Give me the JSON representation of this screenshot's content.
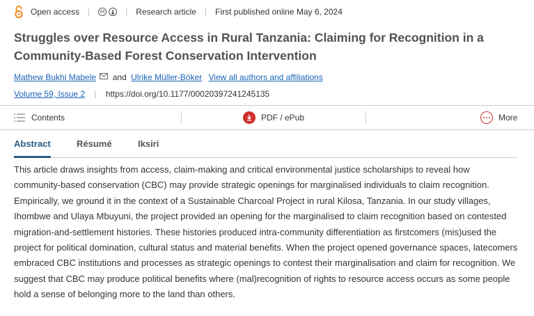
{
  "meta": {
    "access_label": "Open access",
    "cc_icons": [
      "cc-icon",
      "by-icon"
    ],
    "article_type": "Research article",
    "published": "First published online May 6, 2024"
  },
  "article": {
    "title": "Struggles over Resource Access in Rural Tanzania: Claiming for Recognition in a Community-Based Forest Conservation Intervention",
    "author1": "Mathew Bukhi Mabele",
    "and_text": "and",
    "author2": "Ulrike Müller-Böker",
    "view_all": "View all authors and affiliations",
    "volume": "Volume 59, Issue 2",
    "doi": "https://doi.org/10.1177/00020397241245135"
  },
  "toolbar": {
    "contents_label": "Contents",
    "pdf_label": "PDF / ePub",
    "more_label": "More"
  },
  "tabs": [
    {
      "label": "Abstract",
      "active": true
    },
    {
      "label": "Résumé",
      "active": false
    },
    {
      "label": "Iksiri",
      "active": false
    }
  ],
  "abstract": "This article draws insights from access, claim-making and critical environmental justice scholarships to reveal how community-based conservation (CBC) may provide strategic openings for marginalised individuals to claim recognition. Empirically, we ground it in the context of a Sustainable Charcoal Project in rural Kilosa, Tanzania. In our study villages, Ihombwe and Ulaya Mbuyuni, the project provided an opening for the marginalised to claim recognition based on contested migration-and-settlement histories. These histories produced intra-community differentiation as firstcomers (mis)used the project for political domination, cultural status and material benefits. When the project opened governance spaces, latecomers embraced CBC institutions and processes as strategic openings to contest their marginalisation and claim for recognition. We suggest that CBC may produce political benefits where (mal)recognition of rights to resource access occurs as some people hold a sense of belonging more to the land than others.",
  "colors": {
    "accent_orange": "#f08a1c",
    "link_blue": "#1a63b8",
    "tab_active": "#2c5d82",
    "pdf_red": "#d22e2e"
  }
}
